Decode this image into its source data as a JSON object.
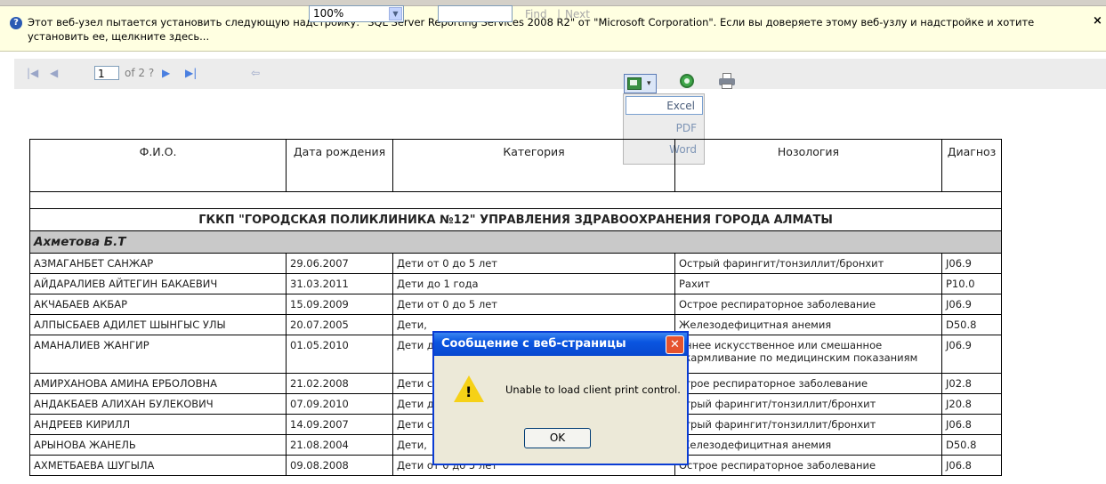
{
  "infobar": {
    "text": "Этот веб-узел пытается установить следующую надстройку: \"SQL Server Reporting Services 2008 R2\" от \"Microsoft Corporation\". Если вы доверяете этому веб-узлу и надстройке и хотите установить ее, щелкните здесь...",
    "close": "×"
  },
  "toolbar": {
    "first_icon": "|◀",
    "prev_icon": "◀",
    "page_value": "1",
    "page_of": "of 2 ?",
    "next_icon": "▶",
    "last_icon": "▶|",
    "back_icon": "⇦",
    "zoom_value": "100%",
    "zoom_arrow": "▼",
    "find_label": "Find",
    "separator": "|",
    "next_label": "Next",
    "export_icon": "export-icon",
    "refresh_icon": "refresh-icon",
    "print_icon": "print-icon"
  },
  "export_menu": [
    "Excel",
    "PDF",
    "Word"
  ],
  "table": {
    "headers": [
      "Ф.И.О.",
      "Дата рождения",
      "Категория",
      "Нозология",
      "Диагноз"
    ],
    "organization": "ГККП \"ГОРОДСКАЯ ПОЛИКЛИНИКА №12\" УПРАВЛЕНИЯ ЗДРАВООХРАНЕНИЯ ГОРОДА АЛМАТЫ",
    "group": "Ахметова Б.Т",
    "rows": [
      {
        "name": "АЗМАГАНБЕТ САНЖАР",
        "dob": "29.06.2007",
        "category": "Дети от 0 до 5 лет",
        "nosology": "Острый фарингит/тонзиллит/бронхит",
        "diag": "J06.9"
      },
      {
        "name": "АЙДАРАЛИЕВ АЙТЕГИН БАКАЕВИЧ",
        "dob": "31.03.2011",
        "category": "Дети до 1 года",
        "nosology": "Рахит",
        "diag": "P10.0"
      },
      {
        "name": "АКЧАБАЕВ АКБАР",
        "dob": "15.09.2009",
        "category": "Дети от 0 до 5 лет",
        "nosology": "Острое респираторное заболевание",
        "diag": "J06.9"
      },
      {
        "name": "АЛПЫСБАЕВ АДИЛЕТ ШЫНГЫС УЛЫ",
        "dob": "20.07.2005",
        "category": "Дети,",
        "nosology": "Железодефицитная анемия",
        "diag": "D50.8"
      },
      {
        "name": "АМАНАЛИЕВ ЖАНГИР",
        "dob": "01.05.2010",
        "category": "Дети д",
        "nosology": "аннее искусственное или смешанное скармливание по медицинским показаниям",
        "diag": "J06.9"
      },
      {
        "name": "АМИРХАНОВА АМИНА ЕРБОЛОВНА",
        "dob": "21.02.2008",
        "category": "Дети с",
        "nosology": "строе респираторное заболевание",
        "diag": "J02.8"
      },
      {
        "name": "АНДАКБАЕВ АЛИХАН БУЛЕКОВИЧ",
        "dob": "07.09.2010",
        "category": "Дети д",
        "nosology": "стрый фарингит/тонзиллит/бронхит",
        "diag": "J20.8"
      },
      {
        "name": "АНДРЕЕВ КИРИЛЛ",
        "dob": "14.09.2007",
        "category": "Дети с",
        "nosology": "стрый фарингит/тонзиллит/бронхит",
        "diag": "J06.8"
      },
      {
        "name": "АРЫНОВА ЖАНЕЛЬ",
        "dob": "21.08.2004",
        "category": "Дети,",
        "nosology": "Железодефицитная анемия",
        "diag": "D50.8"
      },
      {
        "name": "АХМЕТБАЕВА ШУГЫЛА",
        "dob": "09.08.2008",
        "category": "Дети от 0 до 5 лет",
        "nosology": "Острое респираторное заболевание",
        "diag": "J06.8"
      }
    ]
  },
  "dialog": {
    "title": "Сообщение с веб-страницы",
    "message": "Unable to load client print control.",
    "ok": "OK",
    "close": "✕",
    "warning_mark": "!"
  }
}
